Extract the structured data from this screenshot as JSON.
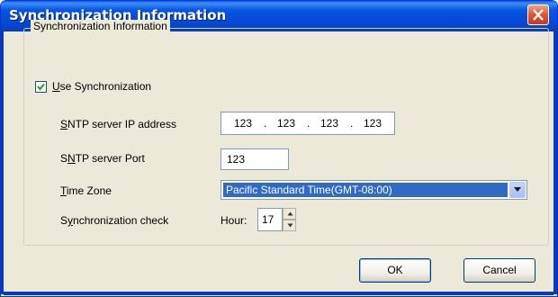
{
  "window": {
    "title": "Synchronization Information",
    "close_icon": "close-x-icon"
  },
  "group": {
    "legend": "Synchronization Information"
  },
  "use_sync": {
    "checked": true,
    "label_hotkey": "U",
    "label_rest": "se Synchronization"
  },
  "sntp_ip": {
    "label_hotkey": "S",
    "label_rest": "NTP server IP address",
    "octets": [
      "123",
      "123",
      "123",
      "123"
    ],
    "separator": "."
  },
  "sntp_port": {
    "label_pre": "S",
    "label_hotkey": "N",
    "label_rest": "TP server Port",
    "value": "123"
  },
  "time_zone": {
    "label_hotkey": "T",
    "label_rest": "ime Zone",
    "selected": "Pacific Standard Time(GMT-08:00)"
  },
  "sync_check": {
    "label_pre": "S",
    "label_hotkey": "y",
    "label_rest": "nchronization check",
    "hour_label": "Hour:",
    "hour_value": "17"
  },
  "buttons": {
    "ok": "OK",
    "cancel": "Cancel"
  },
  "colors": {
    "titlebar": "#0349d7",
    "dialog_bg": "#ece9d8",
    "selection": "#316ac5",
    "close_button": "#e25a33"
  }
}
